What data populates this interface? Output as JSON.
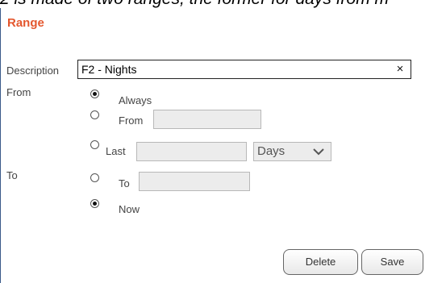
{
  "top_text": "2 is made of two ranges, the former for days from m",
  "panel": {
    "title": "Range"
  },
  "description": {
    "label": "Description",
    "value": "F2 - Nights",
    "clear_glyph": "×"
  },
  "from": {
    "label": "From",
    "options": {
      "always": "Always",
      "from": "From",
      "last": "Last"
    },
    "selected": "always",
    "from_value": "",
    "last_value": "",
    "unit_select": "Days"
  },
  "to": {
    "label": "To",
    "options": {
      "to": "To",
      "now": "Now"
    },
    "selected": "now",
    "to_value": ""
  },
  "buttons": {
    "delete": "Delete",
    "save": "Save"
  }
}
